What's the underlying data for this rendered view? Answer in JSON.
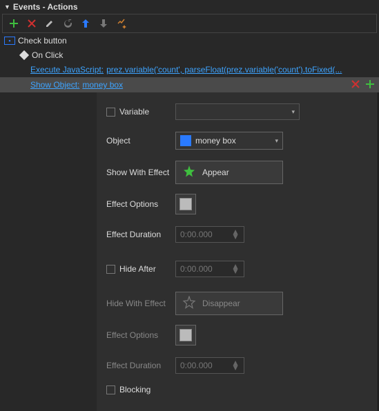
{
  "panel": {
    "title": "Events - Actions"
  },
  "target": {
    "label": "Check button"
  },
  "event": {
    "label": "On Click"
  },
  "actions": [
    {
      "name": "Execute JavaScript:",
      "param": "prez.variable('count', parseFloat(prez.variable('count').toFixed(..."
    },
    {
      "name": "Show Object:",
      "param": "money box"
    }
  ],
  "props": {
    "variable_label": "Variable",
    "object_label": "Object",
    "object_value": "money box",
    "show_effect_label": "Show With Effect",
    "show_effect_value": "Appear",
    "effect_options_label": "Effect Options",
    "effect_duration_label": "Effect Duration",
    "effect_duration_placeholder": "0:00.000",
    "hide_after_label": "Hide After",
    "hide_after_placeholder": "0:00.000",
    "hide_effect_label": "Hide With Effect",
    "hide_effect_value": "Disappear",
    "effect_options2_label": "Effect Options",
    "effect_duration2_label": "Effect Duration",
    "effect_duration2_placeholder": "0:00.000",
    "blocking_label": "Blocking"
  }
}
